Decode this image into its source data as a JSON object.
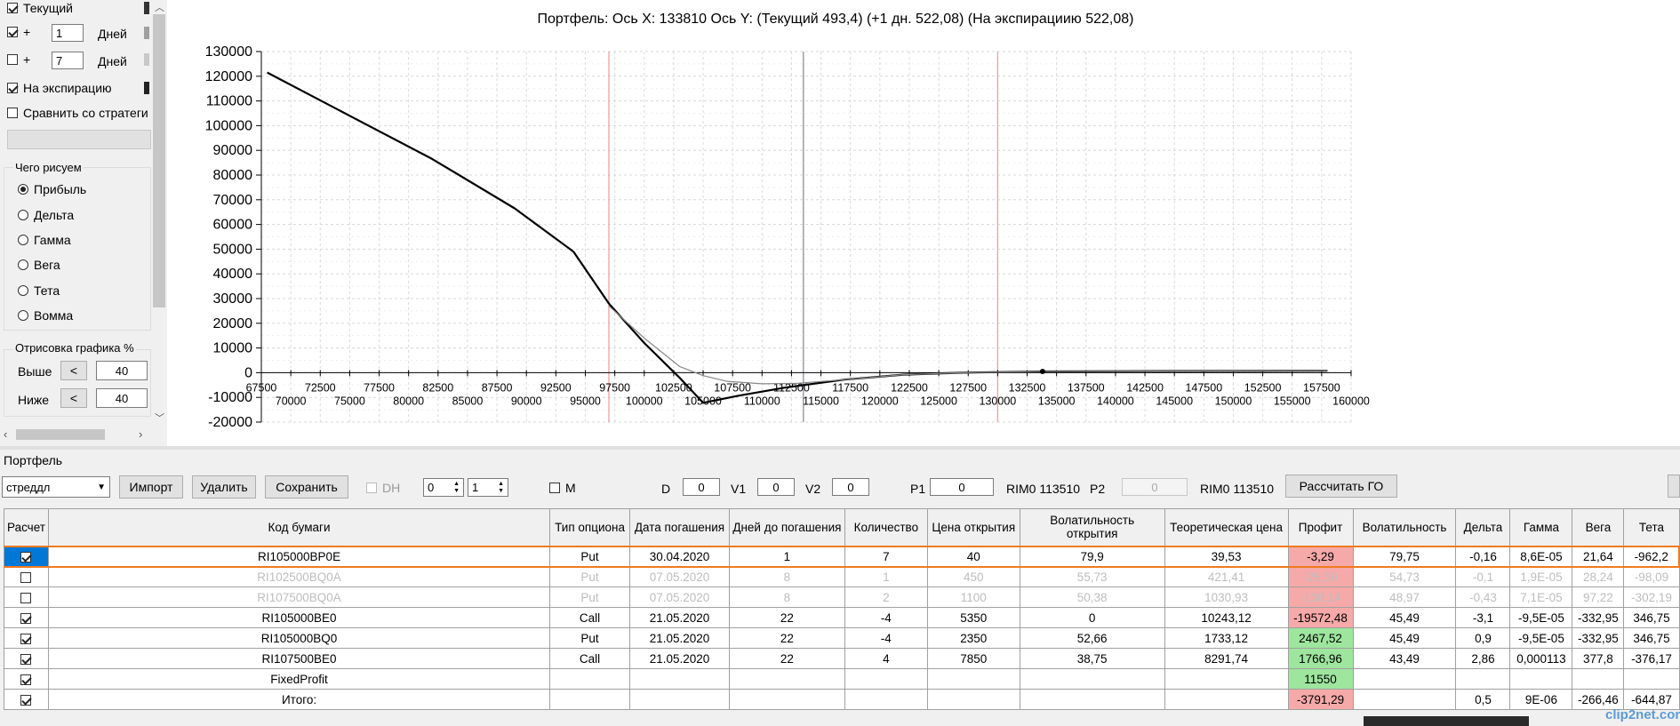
{
  "left_panel": {
    "current_label": "Текущий",
    "plus1_prefix": "+",
    "plus1_value": "1",
    "plus1_unit": "Дней",
    "plus2_prefix": "+",
    "plus2_value": "7",
    "plus2_unit": "Дней",
    "expiry_label": "На экспирацию",
    "compare_label": "Сравнить со стратеги",
    "draw_group_title": "Чего рисуем",
    "draw_options": [
      "Прибыль",
      "Дельта",
      "Гамма",
      "Вега",
      "Тета",
      "Вомма"
    ],
    "render_group_title": "Отрисовка графика %",
    "above_label": "Выше",
    "above_btn": "<",
    "above_value": "40",
    "below_label": "Ниже",
    "below_btn": "<",
    "below_value": "40"
  },
  "chart_data": {
    "type": "line",
    "title": "Портфель: Ось X: 133810 Ось Y:  (Текущий 493,4)  (+1 дн. 522,08)  (На экспирациию 522,08)",
    "xlim": [
      67500,
      160000
    ],
    "ylim": [
      -20000,
      130000
    ],
    "x_ticks_upper": [
      "67500",
      "72500",
      "77500",
      "82500",
      "87500",
      "92500",
      "97500",
      "102500",
      "107500",
      "112500",
      "117500",
      "122500",
      "127500",
      "132500",
      "137500",
      "142500",
      "147500",
      "152500",
      "157500"
    ],
    "x_ticks_lower": [
      "70000",
      "75000",
      "80000",
      "85000",
      "90000",
      "95000",
      "100000",
      "105000",
      "110000",
      "115000",
      "120000",
      "125000",
      "130000",
      "135000",
      "140000",
      "145000",
      "150000",
      "155000",
      "160000"
    ],
    "y_ticks": [
      "130000",
      "120000",
      "110000",
      "100000",
      "90000",
      "80000",
      "70000",
      "60000",
      "50000",
      "40000",
      "30000",
      "20000",
      "10000",
      "0",
      "-10000",
      "-20000"
    ],
    "vlines": [
      {
        "x": 97000,
        "color": "#f0a0a0"
      },
      {
        "x": 113510,
        "color": "#8a8aaa"
      },
      {
        "x": 130000,
        "color": "#f0a0a0"
      }
    ],
    "series": [
      {
        "color": "#000000",
        "points": [
          [
            68000,
            121500
          ],
          [
            75000,
            104000
          ],
          [
            82000,
            86500
          ],
          [
            89000,
            66500
          ],
          [
            94000,
            49000
          ],
          [
            97000,
            28000
          ],
          [
            100000,
            12000
          ],
          [
            103000,
            -2000
          ],
          [
            105000,
            -12200
          ],
          [
            108000,
            -9300
          ],
          [
            112000,
            -6000
          ],
          [
            117000,
            -2800
          ],
          [
            122000,
            -800
          ],
          [
            127000,
            0
          ],
          [
            133810,
            494
          ],
          [
            145000,
            700
          ],
          [
            158000,
            800
          ]
        ]
      },
      {
        "color": "#888888",
        "points": [
          [
            97000,
            27000
          ],
          [
            100000,
            14000
          ],
          [
            103000,
            2500
          ],
          [
            105000,
            -1200
          ],
          [
            107000,
            -3500
          ],
          [
            110000,
            -4500
          ],
          [
            113000,
            -4300
          ],
          [
            117000,
            -2800
          ],
          [
            122000,
            -800
          ],
          [
            127000,
            0
          ],
          [
            133810,
            494
          ],
          [
            145000,
            700
          ],
          [
            158000,
            800
          ]
        ]
      }
    ],
    "marker": {
      "x": 133810,
      "y": 494
    }
  },
  "portfolio": {
    "title": "Портфель",
    "strategy_value": "стреддл",
    "import_label": "Импорт",
    "delete_label": "Удалить",
    "save_label": "Сохранить",
    "dh_label": "DH",
    "spin1_value": "0",
    "spin2_value": "1",
    "m_label": "M",
    "d_label": "D",
    "d_value": "0",
    "v1_label": "V1",
    "v1_value": "0",
    "v2_label": "V2",
    "v2_value": "0",
    "p1_label": "P1",
    "p1_value": "0",
    "rim1_label": "RIM0 113510",
    "p2_label": "P2",
    "p2_value": "0",
    "rim2_label": "RIM0 113510",
    "calc_label": "Рассчитать ГО"
  },
  "table": {
    "headers": [
      "Расчет",
      "Код бумаги",
      "Тип опциона",
      "Дата погашения",
      "Дней до погашения",
      "Количество",
      "Цена открытия",
      "Волатильность открытия",
      "Теоретическая цена",
      "Профит",
      "Волатильность",
      "Дельта",
      "Гамма",
      "Вега",
      "Тета"
    ],
    "rows": [
      {
        "checked": true,
        "code": "RI105000BP0E",
        "type": "Put",
        "date": "30.04.2020",
        "days": "1",
        "qty": "7",
        "open": "40",
        "vol_open": "79,9",
        "theo": "39,53",
        "profit": "-3,29",
        "vol": "79,75",
        "delta": "-0,16",
        "gamma": "8,6E-05",
        "vega": "21,64",
        "theta": "-962,2"
      },
      {
        "checked": false,
        "code": "RI102500BQ0A",
        "type": "Put",
        "date": "07.05.2020",
        "days": "8",
        "qty": "1",
        "open": "450",
        "vol_open": "55,73",
        "theo": "421,41",
        "profit": "-28,59",
        "vol": "54,73",
        "delta": "-0,1",
        "gamma": "1,9E-05",
        "vega": "28,24",
        "theta": "-98,09"
      },
      {
        "checked": false,
        "code": "RI107500BQ0A",
        "type": "Put",
        "date": "07.05.2020",
        "days": "8",
        "qty": "2",
        "open": "1100",
        "vol_open": "50,38",
        "theo": "1030,93",
        "profit": "-138,14",
        "vol": "48,97",
        "delta": "-0,43",
        "gamma": "7,1E-05",
        "vega": "97,22",
        "theta": "-302,19"
      },
      {
        "checked": true,
        "code": "RI105000BE0",
        "type": "Call",
        "date": "21.05.2020",
        "days": "22",
        "qty": "-4",
        "open": "5350",
        "vol_open": "0",
        "theo": "10243,12",
        "profit": "-19572,48",
        "vol": "45,49",
        "delta": "-3,1",
        "gamma": "-9,5E-05",
        "vega": "-332,95",
        "theta": "346,75"
      },
      {
        "checked": true,
        "code": "RI105000BQ0",
        "type": "Put",
        "date": "21.05.2020",
        "days": "22",
        "qty": "-4",
        "open": "2350",
        "vol_open": "52,66",
        "theo": "1733,12",
        "profit": "2467,52",
        "vol": "45,49",
        "delta": "0,9",
        "gamma": "-9,5E-05",
        "vega": "-332,95",
        "theta": "346,75"
      },
      {
        "checked": true,
        "code": "RI107500BE0",
        "type": "Call",
        "date": "21.05.2020",
        "days": "22",
        "qty": "4",
        "open": "7850",
        "vol_open": "38,75",
        "theo": "8291,74",
        "profit": "1766,96",
        "vol": "43,49",
        "delta": "2,86",
        "gamma": "0,000113",
        "vega": "377,8",
        "theta": "-376,17"
      },
      {
        "checked": true,
        "code": "FixedProfit",
        "type": "",
        "date": "",
        "days": "",
        "qty": "",
        "open": "",
        "vol_open": "",
        "theo": "",
        "profit": "11550",
        "vol": "",
        "delta": "",
        "gamma": "",
        "vega": "",
        "theta": ""
      },
      {
        "checked": true,
        "code": "Итого:",
        "type": "",
        "date": "",
        "days": "",
        "qty": "",
        "open": "",
        "vol_open": "",
        "theo": "",
        "profit": "-3791,29",
        "vol": "",
        "delta": "0,5",
        "gamma": "9E-06",
        "vega": "-266,46",
        "theta": "-644,87"
      }
    ]
  },
  "watermark": "clip2net.com",
  "colors": {
    "profit_negative": "#f6a9a9",
    "profit_positive": "#9ee59e",
    "selected_row_border": "#f07a1e",
    "checkbox_selected_bg": "#0078d7"
  }
}
